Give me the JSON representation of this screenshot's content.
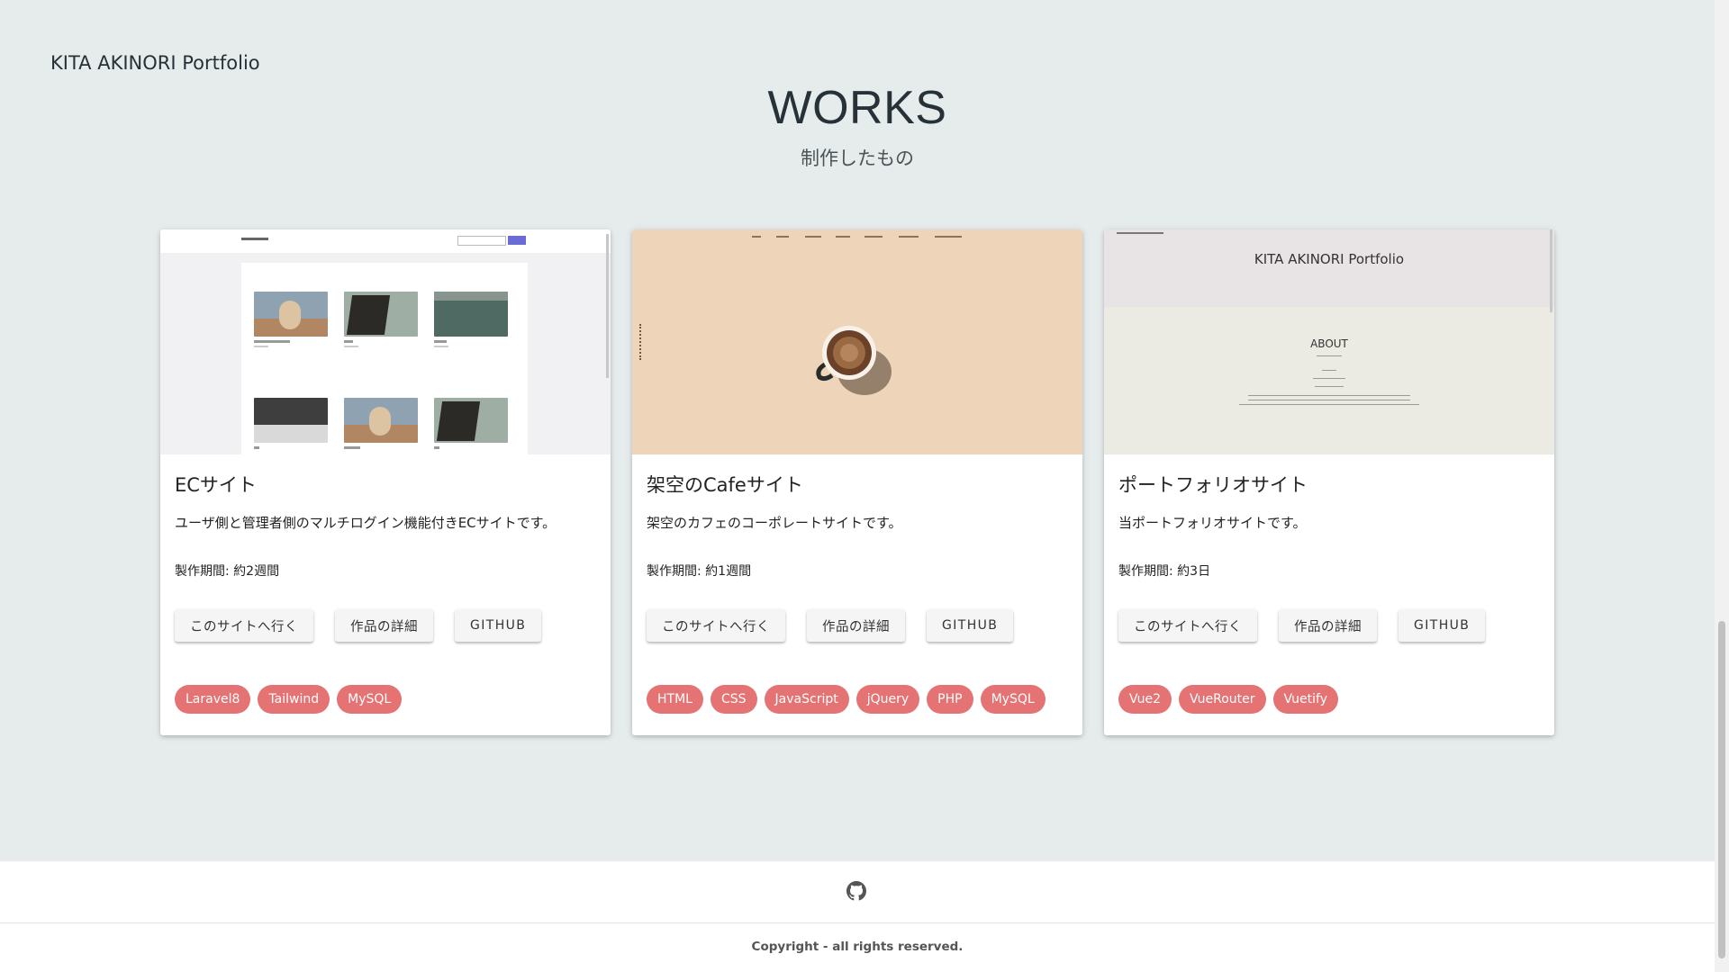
{
  "header": {
    "brand": "KITA AKINORI Portfolio"
  },
  "section": {
    "title": "WORKS",
    "subtitle": "制作したもの"
  },
  "works": [
    {
      "title": "ECサイト",
      "description": "ユーザ側と管理者側のマルチログイン機能付きECサイトです。",
      "period_label": "製作期間:",
      "period_value": "約2週間",
      "buttons": {
        "visit": "このサイトへ行く",
        "detail": "作品の詳細",
        "github": "GITHUB"
      },
      "tags": [
        "Laravel8",
        "Tailwind",
        "MySQL"
      ],
      "thumbnail": "ec-site-screenshot"
    },
    {
      "title": "架空のCafeサイト",
      "description": "架空のカフェのコーポレートサイトです。",
      "period_label": "製作期間:",
      "period_value": "約1週間",
      "buttons": {
        "visit": "このサイトへ行く",
        "detail": "作品の詳細",
        "github": "GITHUB"
      },
      "tags": [
        "HTML",
        "CSS",
        "JavaScript",
        "jQuery",
        "PHP",
        "MySQL"
      ],
      "thumbnail": "cafe-site-screenshot"
    },
    {
      "title": "ポートフォリオサイト",
      "description": "当ポートフォリオサイトです。",
      "period_label": "製作期間:",
      "period_value": "約3日",
      "buttons": {
        "visit": "このサイトへ行く",
        "detail": "作品の詳細",
        "github": "GITHUB"
      },
      "tags": [
        "Vue2",
        "VueRouter",
        "Vuetify"
      ],
      "thumbnail": "portfolio-site-screenshot",
      "thumbnail_text": {
        "brand": "KITA AKINORI Portfolio",
        "about": "ABOUT"
      }
    }
  ],
  "footer": {
    "icon": "github-icon",
    "copyright": "Copyright - all rights reserved."
  },
  "colors": {
    "background": "#e6ebec",
    "chip": "#e57373",
    "card": "#ffffff",
    "text": "#263238"
  }
}
